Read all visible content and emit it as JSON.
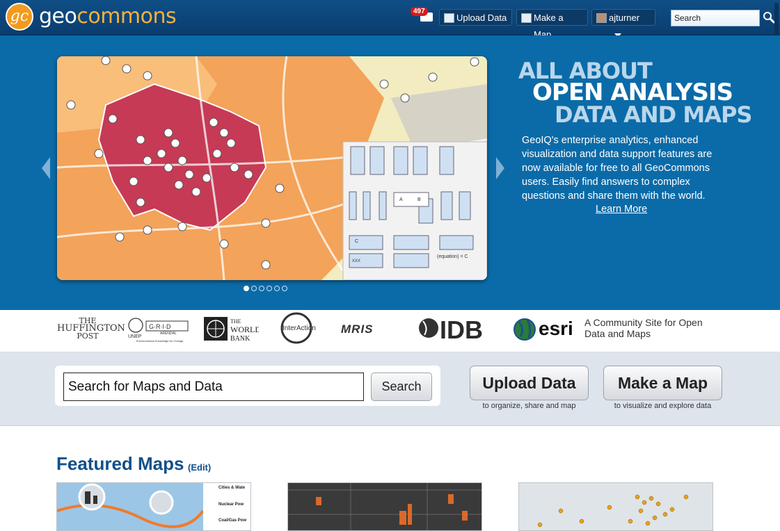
{
  "topbar": {
    "logo_mark": "gc",
    "logo_geo": "geo",
    "logo_commons": "commons",
    "notification_count": "497",
    "upload_label": "Upload Data",
    "make_map_label": "Make a Map",
    "user_label": "ajturner",
    "search_placeholder": "Search",
    "icons": [
      "envelope-icon",
      "upload-icon",
      "map-icon",
      "avatar",
      "chevron-down-icon",
      "search-icon"
    ]
  },
  "hero": {
    "headline_1": "ALL ABOUT",
    "headline_2": "OPEN ANALYSIS",
    "headline_3": "DATA AND MAPS",
    "description": "GeoIQ's enterprise analytics, enhanced visualization and data support features are now available for free to all GeoCommons users. Easily find answers to complex questions and share them with the world.",
    "learn_more": "Learn More",
    "slide_count": 6,
    "active_slide": 1,
    "diagram_labels": {
      "a": "A",
      "b": "B",
      "c": "C",
      "xxx": "XXX",
      "equation": "(equation) = C"
    }
  },
  "partners": {
    "huffington": [
      "THE",
      "HUFFINGTON",
      "POST"
    ],
    "unep": "UNEP",
    "grid": "G·R·I·D",
    "grid_sub": "ARENDAL",
    "grid_tag": "Environmental Knowledge for Change",
    "worldbank": [
      "THE",
      "WORLD",
      "BANK"
    ],
    "interaction": "InterAction",
    "mris": "MRIS",
    "idb": "IDB",
    "esri": "esri",
    "community": [
      "A Community Site for Open",
      "Data and Maps"
    ]
  },
  "search_band": {
    "search_value": "Search for Maps and Data",
    "search_button": "Search",
    "upload_button": "Upload Data",
    "upload_sub": "to organize, share and map",
    "make_map_button": "Make a Map",
    "make_map_sub": "to visualize and explore data"
  },
  "featured": {
    "title": "Featured Maps",
    "edit_label": "(Edit)",
    "thumb1_legend": [
      "Cities & Wate",
      "Nuclear Pow",
      "Coal/Gas Pow"
    ]
  },
  "colors": {
    "topbar": "#0a3d6e",
    "hero": "#0b6ba8",
    "accent_orange": "#f29a1f",
    "featured_blue": "#11508a"
  }
}
